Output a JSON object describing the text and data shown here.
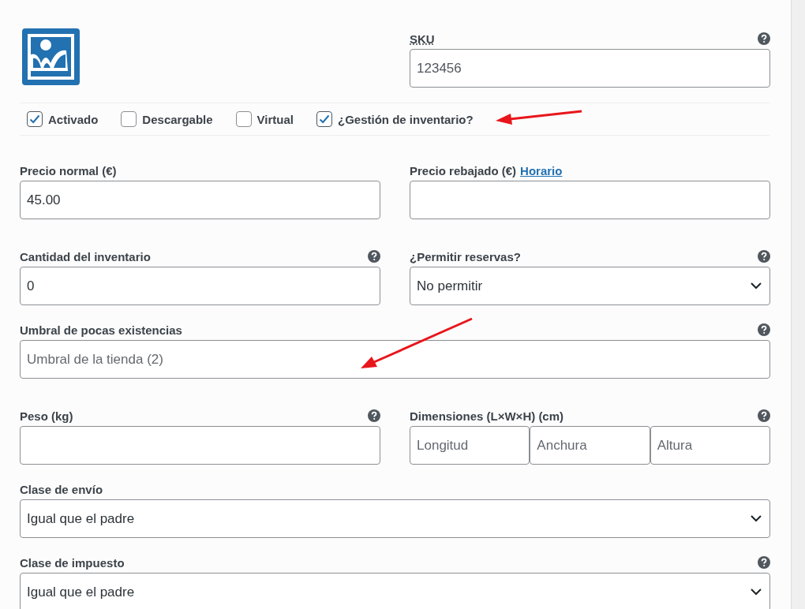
{
  "sku": {
    "label": "SKU",
    "value": "123456",
    "help": true
  },
  "options": [
    {
      "label": "Activado",
      "checked": true
    },
    {
      "label": "Descargable",
      "checked": false
    },
    {
      "label": "Virtual",
      "checked": false
    },
    {
      "label": "¿Gestión de inventario?",
      "checked": true
    }
  ],
  "sections": [
    [
      [
        {
          "kind": "text",
          "label": "Precio normal (€)",
          "value": "45.00"
        },
        {
          "kind": "text",
          "label": "Precio rebajado (€)",
          "link": "Horario"
        }
      ]
    ],
    [
      [
        {
          "kind": "text",
          "label": "Cantidad del inventario",
          "value": "0",
          "help": true
        },
        {
          "kind": "select",
          "label": "¿Permitir reservas?",
          "value": "No permitir",
          "help": true
        }
      ]
    ],
    [
      [
        {
          "kind": "text",
          "label": "Umbral de pocas existencias",
          "placeholder": "Umbral de la tienda (2)",
          "help": true
        }
      ]
    ],
    [
      [
        {
          "kind": "text",
          "label": "Peso (kg)",
          "help": true
        },
        {
          "kind": "dimensions",
          "label": "Dimensiones (L×W×H) (cm)",
          "help": true,
          "parts": [
            {
              "placeholder": "Longitud"
            },
            {
              "placeholder": "Anchura"
            },
            {
              "placeholder": "Altura"
            }
          ]
        }
      ]
    ],
    [
      [
        {
          "kind": "select",
          "label": "Clase de envío",
          "value": "Igual que el padre"
        }
      ]
    ],
    [
      [
        {
          "kind": "select",
          "label": "Clase de impuesto",
          "value": "Igual que el padre",
          "help": true
        }
      ]
    ]
  ]
}
